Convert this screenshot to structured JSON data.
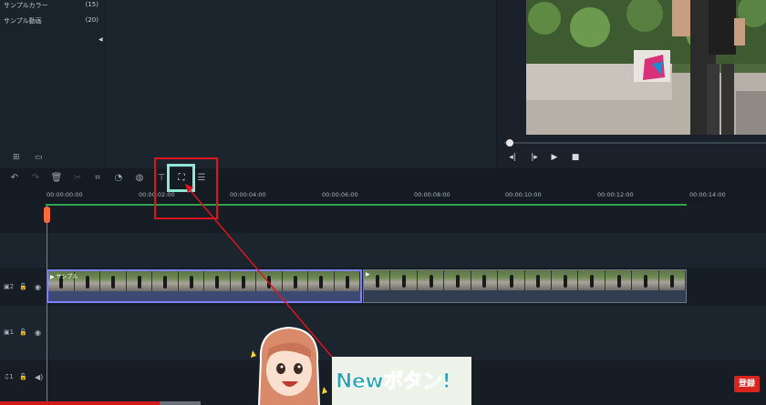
{
  "media_panel": {
    "items": [
      {
        "label": "サンプルカラー",
        "count": "(15)"
      },
      {
        "label": "サンプル動画",
        "count": "(20)"
      }
    ]
  },
  "player": {
    "buttons": [
      "prev-frame-icon",
      "play-frame-icon",
      "play-icon",
      "stop-icon"
    ]
  },
  "toolbar": {
    "tools": [
      "undo-icon",
      "redo-icon",
      "delete-icon",
      "cut-icon",
      "crop-icon",
      "speed-icon",
      "color-icon",
      "split-icon",
      "new-autoreframe-icon",
      "adjust-icon"
    ]
  },
  "ruler": {
    "labels": [
      "00:00:00:00",
      "00:00:02:00",
      "00:00:04:00",
      "00:00:06:00",
      "00:00:08:00",
      "00:00:10:00",
      "00:00:12:00",
      "00:00:14:00"
    ]
  },
  "tracks": [
    {
      "id": "video-2",
      "label": "2"
    },
    {
      "id": "video-1",
      "label": "1"
    },
    {
      "id": "audio-1",
      "label": "1"
    }
  ],
  "clips": {
    "clip1_title": "サンプル",
    "clip2_title": ""
  },
  "annotation": {
    "banner_text": "Newボタン!",
    "badge_text": "登録"
  },
  "colors": {
    "accent_red": "#e0141e",
    "highlight_teal": "#8ee6d3",
    "timeline_green": "#2ea44f",
    "playhead": "#ff6a3d"
  }
}
